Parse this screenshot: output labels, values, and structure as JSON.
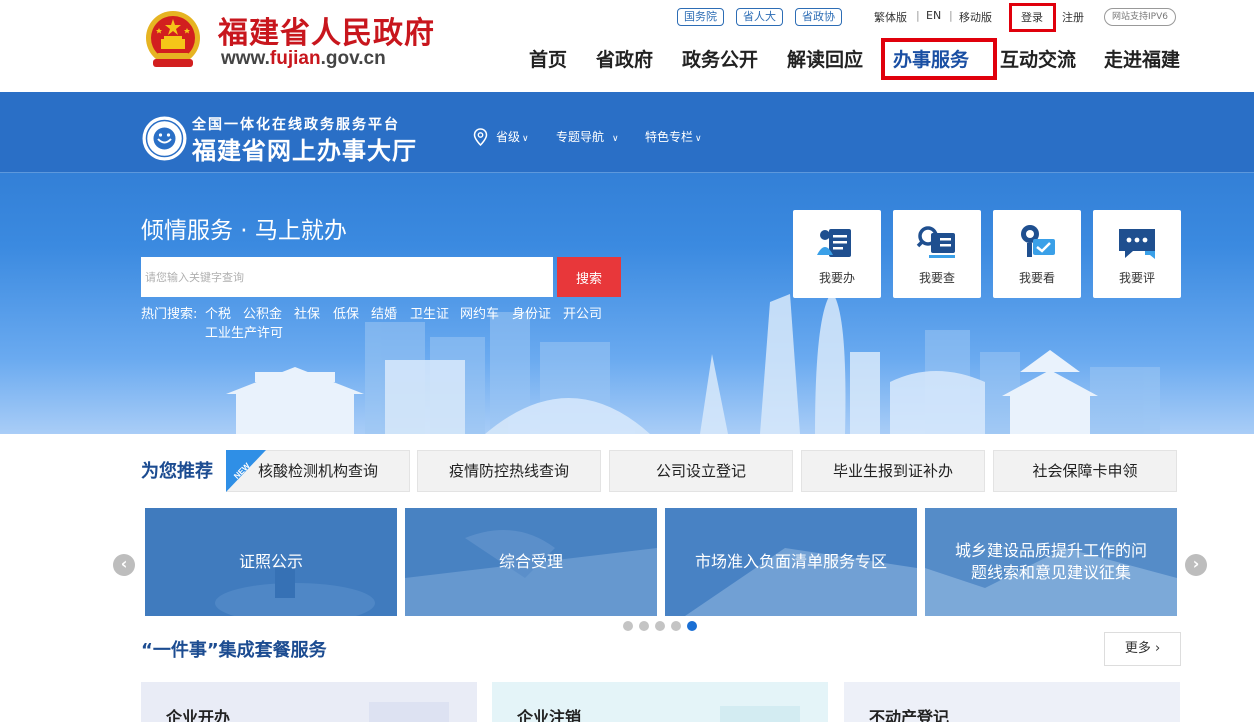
{
  "header": {
    "gov_name": "福建省人民政府",
    "url_prefix": "www.",
    "url_highlight": "fujian",
    "url_suffix": ".gov.cn",
    "site_tags": [
      "国务院",
      "省人大",
      "省政协"
    ],
    "utility": {
      "traditional": "繁体版",
      "english": "EN",
      "mobile": "移动版",
      "login": "登录",
      "register": "注册"
    },
    "ipv6": "网站支持IPV6",
    "nav": [
      "首页",
      "省政府",
      "政务公开",
      "解读回应",
      "办事服务",
      "互动交流",
      "走进福建"
    ],
    "active_nav": "办事服务",
    "highlight_color": "#e0000c"
  },
  "hall": {
    "subtitle": "全国一体化在线政务服务平台",
    "title": "福建省网上办事大厅",
    "menu": {
      "region": "省级",
      "topic": "专题导航",
      "special": "特色专栏"
    }
  },
  "hero": {
    "slogan": "倾情服务 · 马上就办",
    "search_placeholder": "请您输入关键字查询",
    "search_button": "搜索",
    "hot_label": "热门搜索:",
    "hot_items": [
      "个税",
      "公积金",
      "社保",
      "低保",
      "结婚",
      "卫生证",
      "网约车",
      "身份证",
      "开公司",
      "工业生产许可"
    ],
    "services": [
      {
        "label": "我要办",
        "icon": "apply-icon"
      },
      {
        "label": "我要查",
        "icon": "query-icon"
      },
      {
        "label": "我要看",
        "icon": "view-icon"
      },
      {
        "label": "我要评",
        "icon": "comment-icon"
      }
    ]
  },
  "recommend": {
    "title": "为您推荐",
    "new_badge": "NEW",
    "items": [
      "核酸检测机构查询",
      "疫情防控热线查询",
      "公司设立登记",
      "毕业生报到证补办",
      "社会保障卡申领"
    ]
  },
  "carousel": {
    "slides": [
      "证照公示",
      "综合受理",
      "市场准入负面清单服务专区",
      "城乡建设品质提升工作的问题线索和意见建议征集"
    ],
    "dot_count": 5,
    "active_dot": 5
  },
  "package": {
    "title": "“一件事”集成套餐服务",
    "more": "更多",
    "cards": [
      "企业开办",
      "企业注销",
      "不动产登记"
    ]
  }
}
